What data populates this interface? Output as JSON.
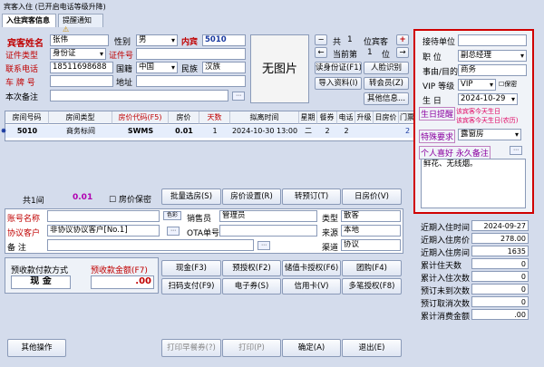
{
  "window": {
    "title": "宾客入住 (已开启电话等级升降)"
  },
  "tabs": [
    {
      "label": "入住宾客信息"
    },
    {
      "label": "提醒通知"
    }
  ],
  "guest": {
    "name_label": "宾客姓名",
    "name": "张伟",
    "sex_label": "性别",
    "sex": "男",
    "vip_label": "内宾",
    "room_no": "5010",
    "idtype_label": "证件类型",
    "idtype": "身份证",
    "idno_label": "证件号",
    "idno": "",
    "phone_label": "联系电话",
    "phone": "18511698688",
    "nation_label": "国籍",
    "nation": "中国",
    "ethnic_label": "民族",
    "ethnic": "汉族",
    "plate_label": "车 牌 号",
    "plate": "",
    "addr_label": "地址",
    "addr": "",
    "remark_label": "本次备注",
    "remark": "",
    "photo": "无图片"
  },
  "nav": {
    "total_label": "共",
    "total": "1",
    "unit": "位宾客",
    "cur_label": "当前第",
    "cur": "1",
    "unit2": "位",
    "minus": "−",
    "plus": "+",
    "prev": "←",
    "next": "→"
  },
  "buttons": {
    "read_id": "读身份证(F1)",
    "face": "人脸识别",
    "import": "导入资料(I)",
    "member": "转会员(Z)",
    "other": "其他信息..."
  },
  "grid": {
    "headers": [
      "房间号码",
      "房间类型",
      "房价代码(F5)",
      "房价",
      "天数",
      "拟离时间",
      "星期",
      "餐券",
      "电话",
      "升级",
      "日房价",
      "门票"
    ],
    "row": [
      "5010",
      "商务标间",
      "SWMS",
      "0.01",
      "1",
      "2024-10-30 13:00",
      "二",
      "2",
      "2",
      "",
      "",
      "2"
    ]
  },
  "summary": {
    "total_label": "共1间",
    "total_value": "0.01",
    "secret_label": "房价保密",
    "batch": "批量选房(S)",
    "price_set": "房价设置(R)",
    "transfer": "转预订(T)",
    "dayprice": "日房价(V)"
  },
  "account": {
    "acct_label": "账号名称",
    "acct": "",
    "color": "色彩",
    "sales_label": "销售员",
    "sales": "管理员",
    "type_label": "类型",
    "type": "散客",
    "proto_label": "协议客户",
    "proto": "非协议协议客户[No.1]",
    "ota_label": "OTA单号",
    "ota": "",
    "src_label": "来源",
    "src": "本地",
    "note_label": "备 注",
    "note": "",
    "chan_label": "渠道",
    "chan": "协议"
  },
  "pay": {
    "method_label": "预收款付款方式",
    "method": "现 金",
    "amount_label": "预收款金额(F7)",
    "amount": ".00",
    "cash": "现金(F3)",
    "preauth": "预授权(F2)",
    "card_preauth": "储值卡授权(F6)",
    "group": "团购(F4)",
    "scan": "扫码支付(F9)",
    "ecoupon": "电子券(S)",
    "credit": "信用卡(V)",
    "multi": "多笔授权(F8)"
  },
  "footer": {
    "other": "其他操作",
    "print_meal": "打印早餐券(?)",
    "print": "打印(P)",
    "ok": "确定(A)",
    "exit": "退出(E)"
  },
  "right": {
    "unit_label": "接待单位",
    "unit": "",
    "pos_label": "职 位",
    "pos": "副总经理",
    "purpose_label": "事由/目的",
    "purpose": "商务",
    "vip_label": "VIP 等级",
    "vip": "VIP",
    "secret": "保密",
    "bday_label": "生 日",
    "bday": "2024-10-29",
    "bremind_label": "生日提醒",
    "bremind1": "该宾客今天生日",
    "bremind2": "该宾客今天生日(农历)",
    "special_label": "特殊要求",
    "special": "露窗房",
    "hobby_label": "个人喜好 永久备注",
    "hobby": "鲜花、无线烟。"
  },
  "stats": [
    {
      "label": "近期入住时间",
      "value": "2024-09-27"
    },
    {
      "label": "近期入住房价",
      "value": "278.00"
    },
    {
      "label": "近期入住房间",
      "value": "1635"
    },
    {
      "label": "累计住天数",
      "value": "0"
    },
    {
      "label": "累计入住次数",
      "value": "0"
    },
    {
      "label": "预订未到次数",
      "value": "0"
    },
    {
      "label": "预订取消次数",
      "value": "0"
    },
    {
      "label": "累计消费金额",
      "value": ".00"
    }
  ]
}
